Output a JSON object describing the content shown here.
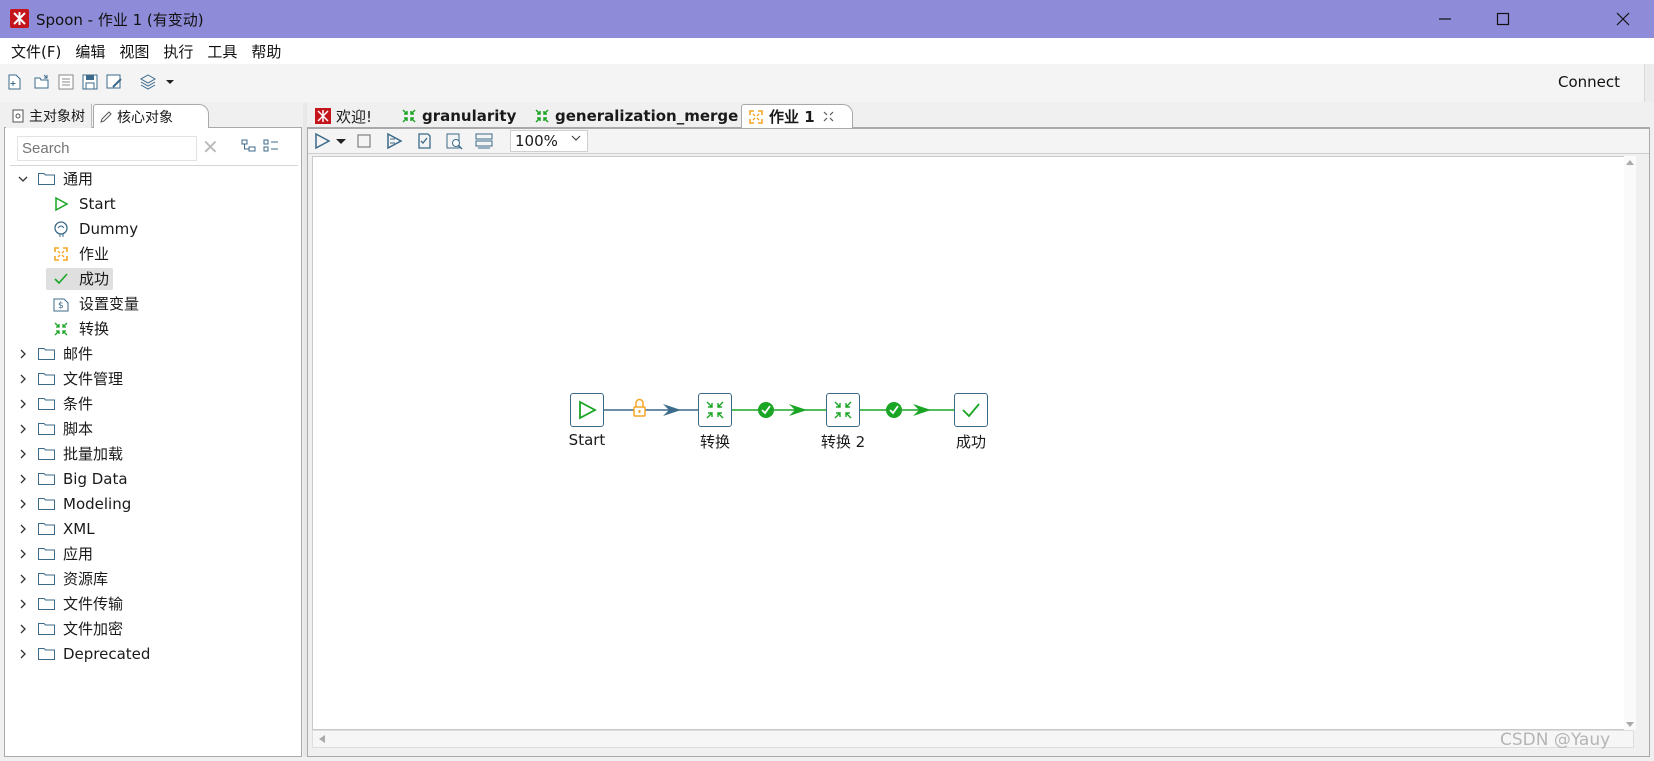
{
  "window": {
    "title": "Spoon - 作业 1 (有变动)",
    "controls": [
      "minimize",
      "maximize",
      "close"
    ]
  },
  "menu": {
    "items": [
      "文件(F)",
      "编辑",
      "视图",
      "执行",
      "工具",
      "帮助"
    ]
  },
  "toolbar": {
    "icons": [
      "new-file-icon",
      "open-file-icon",
      "explore-repository-icon",
      "save-icon",
      "save-as-icon",
      "perspective-layers-icon",
      "dropdown-arrow-icon"
    ],
    "connect_label": "Connect"
  },
  "left_panel": {
    "tabs": [
      {
        "label": "主对象树",
        "active": false
      },
      {
        "label": "核心对象",
        "active": true
      }
    ],
    "search": {
      "placeholder": "Search"
    },
    "tree": {
      "expanded_folder": "通用",
      "leaves": [
        {
          "label": "Start",
          "icon": "start-icon"
        },
        {
          "label": "Dummy",
          "icon": "dummy-icon"
        },
        {
          "label": "作业",
          "icon": "job-icon"
        },
        {
          "label": "成功",
          "icon": "success-icon",
          "selected": true
        },
        {
          "label": "设置变量",
          "icon": "set-variables-icon"
        },
        {
          "label": "转换",
          "icon": "transformation-icon"
        }
      ],
      "collapsed_folders": [
        "邮件",
        "文件管理",
        "条件",
        "脚本",
        "批量加载",
        "Big Data",
        "Modeling",
        "XML",
        "应用",
        "资源库",
        "文件传输",
        "文件加密",
        "Deprecated"
      ]
    }
  },
  "editor": {
    "tabs": [
      {
        "label": "欢迎!",
        "icon": "spoon-logo-icon",
        "active": false
      },
      {
        "label": "granularity",
        "icon": "transformation-icon",
        "active": false
      },
      {
        "label": "generalization_merge",
        "icon": "transformation-icon",
        "active": false
      },
      {
        "label": "作业 1",
        "icon": "job-icon",
        "active": true,
        "closable": true
      }
    ],
    "canvas_toolbar": {
      "icons": [
        "run-icon",
        "run-dropdown-icon",
        "stop-icon",
        "run-options-icon",
        "verify-icon",
        "preview-icon",
        "sql-icon"
      ],
      "zoom": "100%"
    },
    "job": {
      "nodes": [
        {
          "label": "Start",
          "type": "start"
        },
        {
          "label": "转换",
          "type": "transformation"
        },
        {
          "label": "转换 2",
          "type": "transformation"
        },
        {
          "label": "成功",
          "type": "success"
        }
      ],
      "hops": [
        {
          "from": "Start",
          "to": "转换",
          "condition": "unconditional"
        },
        {
          "from": "转换",
          "to": "转换 2",
          "condition": "success"
        },
        {
          "from": "转换 2",
          "to": "成功",
          "condition": "success"
        }
      ]
    }
  },
  "watermark": "CSDN @Yauy",
  "colors": {
    "titlebar": "#8e8bd8",
    "hop_success": "#1aa524",
    "hop_unconditional": "#3b6a8a",
    "lock": "#f5a623",
    "node_border": "#3b6a8a",
    "start_green": "#1aa524"
  }
}
